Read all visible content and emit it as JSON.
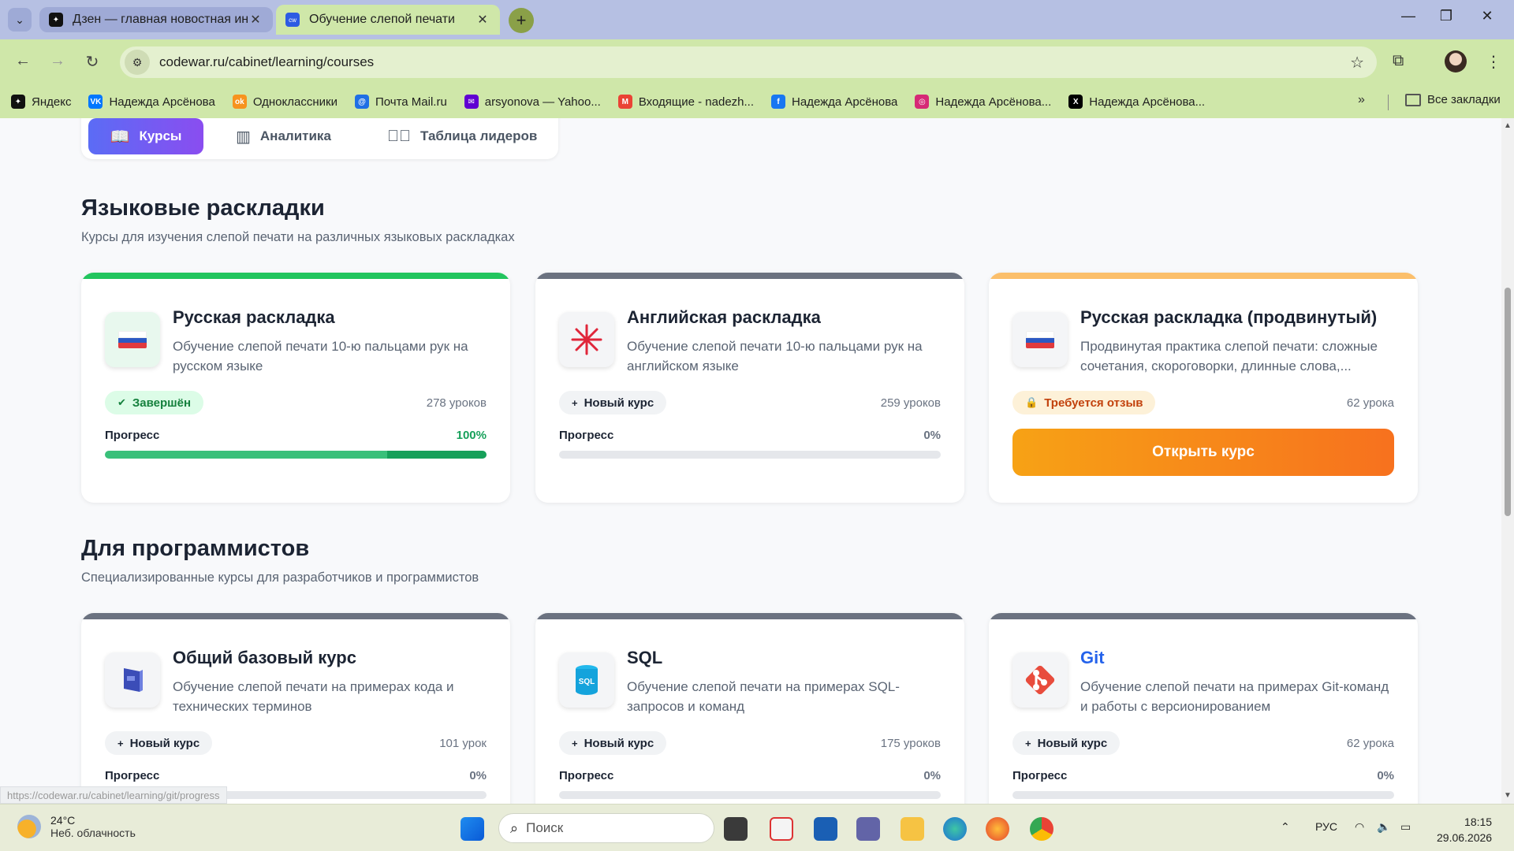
{
  "browser": {
    "tabs": [
      {
        "title": "Дзен — главная новостная ин",
        "active": false
      },
      {
        "title": "Обучение слепой печати",
        "active": true
      }
    ],
    "url": "codewar.ru/cabinet/learning/courses",
    "bookmarks": [
      {
        "label": "Яндекс",
        "color": "#111111",
        "glyph": "✦"
      },
      {
        "label": "Надежда Арсёнова",
        "color": "#0077ff",
        "glyph": "VK"
      },
      {
        "label": "Одноклассники",
        "color": "#f7931e",
        "glyph": "ok"
      },
      {
        "label": "Почта Mail.ru",
        "color": "#1f6fe5",
        "glyph": "@"
      },
      {
        "label": "arsyonova — Yahoo...",
        "color": "#6001d2",
        "glyph": "✉"
      },
      {
        "label": "Входящие - nadezh...",
        "color": "#ea4335",
        "glyph": "M"
      },
      {
        "label": "Надежда Арсёнова",
        "color": "#1877f2",
        "glyph": "f"
      },
      {
        "label": "Надежда Арсёнова...",
        "color": "#d62976",
        "glyph": "◎"
      },
      {
        "label": "Надежда Арсёнова...",
        "color": "#000000",
        "glyph": "X"
      }
    ],
    "all_bookmarks": "Все закладки"
  },
  "nav": {
    "tabs": [
      {
        "label": "Курсы",
        "icon": "book-icon",
        "active": true
      },
      {
        "label": "Аналитика",
        "icon": "bar-chart-icon",
        "active": false
      },
      {
        "label": "Таблица лидеров",
        "icon": "check-circle-icon",
        "active": false
      }
    ]
  },
  "sections": [
    {
      "title": "Языковые раскладки",
      "subtitle": "Курсы для изучения слепой печати на различных языковых раскладках",
      "cards": [
        {
          "title": "Русская раскладка",
          "description": "Обучение слепой печати 10-ю пальцами рук на русском языке",
          "badge": "Завершён",
          "badge_icon": "✔",
          "lessons": "278 уроков",
          "progress_label": "Прогресс",
          "progress_text": "100%",
          "progress": 100,
          "topbar": "#22c55e",
          "icon": "russian-flag-icon"
        },
        {
          "title": "Английская раскладка",
          "description": "Обучение слепой печати 10-ю пальцами рук на английском языке",
          "badge": "Новый курс",
          "badge_icon": "+",
          "lessons": "259 уроков",
          "progress_label": "Прогресс",
          "progress_text": "0%",
          "progress": 0,
          "topbar": "#6b7280",
          "icon": "uk-flag-icon"
        },
        {
          "title": "Русская раскладка (продвинутый)",
          "description": "Продвинутая практика слепой печати: сложные сочетания, скороговорки, длинные слова,...",
          "badge": "Требуется отзыв",
          "badge_icon": "🔒",
          "lessons": "62 урока",
          "button": "Открыть курс",
          "topbar": "#fbbf6b",
          "icon": "russian-flag-icon"
        }
      ]
    },
    {
      "title": "Для программистов",
      "subtitle": "Специализированные курсы для разработчиков и программистов",
      "cards": [
        {
          "title": "Общий базовый курс",
          "description": "Обучение слепой печати на примерах кода и технических терминов",
          "badge": "Новый курс",
          "badge_icon": "+",
          "lessons": "101 урок",
          "progress_label": "Прогресс",
          "progress_text": "0%",
          "progress": 0,
          "topbar": "#6b7280",
          "icon": "code-book-icon"
        },
        {
          "title": "SQL",
          "description": "Обучение слепой печати на примерах SQL-запросов и команд",
          "badge": "Новый курс",
          "badge_icon": "+",
          "lessons": "175 уроков",
          "progress_label": "Прогресс",
          "progress_text": "0%",
          "progress": 0,
          "topbar": "#6b7280",
          "icon": "sql-database-icon",
          "icon_text": "SQL"
        },
        {
          "title": "Git",
          "description": "Обучение слепой печати на примерах Git-команд и работы с версионированием",
          "badge": "Новый курс",
          "badge_icon": "+",
          "lessons": "62 урока",
          "progress_label": "Прогресс",
          "progress_text": "0%",
          "progress": 0,
          "topbar": "#6b7280",
          "icon": "git-icon",
          "title_color": "#2563eb"
        }
      ]
    }
  ],
  "status_bar_url": "https://codewar.ru/cabinet/learning/git/progress",
  "taskbar": {
    "weather_temp": "24°C",
    "weather_text": "Неб. облачность",
    "search_placeholder": "Поиск",
    "language": "РУС",
    "time": "18:15",
    "date": "29.06.2026"
  }
}
